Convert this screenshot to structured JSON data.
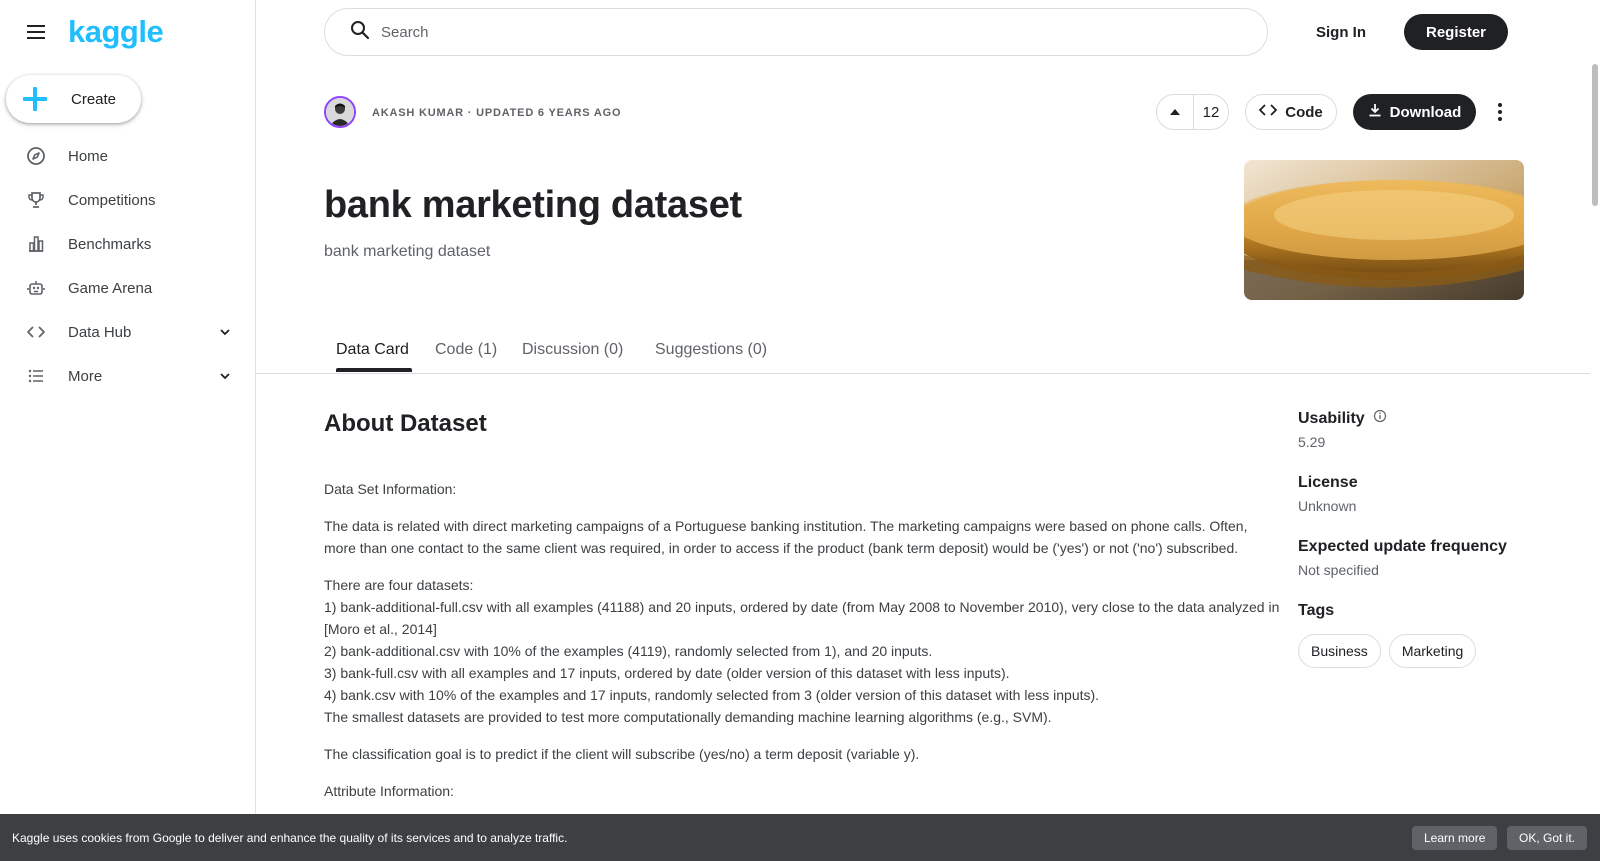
{
  "brand": {
    "logo_text": "kaggle",
    "accent": "#20beff",
    "dark": "#202124"
  },
  "sidebar": {
    "create_label": "Create",
    "items": [
      {
        "label": "Home",
        "icon": "compass-icon"
      },
      {
        "label": "Competitions",
        "icon": "trophy-icon"
      },
      {
        "label": "Benchmarks",
        "icon": "bar-chart-icon"
      },
      {
        "label": "Game Arena",
        "icon": "robot-icon"
      },
      {
        "label": "Data Hub",
        "icon": "code-icon",
        "expandable": true
      },
      {
        "label": "More",
        "icon": "list-icon",
        "expandable": true
      }
    ]
  },
  "header": {
    "search_placeholder": "Search",
    "sign_in": "Sign In",
    "register": "Register"
  },
  "dataset": {
    "owner": "AKASH KUMAR",
    "separator": " · ",
    "updated": "UPDATED 6 YEARS AGO",
    "votes": "12",
    "code_label": "Code",
    "download_label": "Download",
    "title": "bank marketing dataset",
    "subtitle": "bank marketing dataset"
  },
  "tabs": [
    {
      "label": "Data Card",
      "active": true
    },
    {
      "label": "Code (1)"
    },
    {
      "label": "Discussion (0)"
    },
    {
      "label": "Suggestions (0)"
    }
  ],
  "about": {
    "heading": "About Dataset",
    "p1": "Data Set Information:",
    "p2": "The data is related with direct marketing campaigns of a Portuguese banking institution. The marketing campaigns were based on phone calls. Often, more than one contact to the same client was required, in order to access if the product (bank term deposit) would be ('yes') or not ('no') subscribed.",
    "p3_lines": [
      "There are four datasets:",
      "1) bank-additional-full.csv with all examples (41188) and 20 inputs, ordered by date (from May 2008 to November 2010), very close to the data analyzed in [Moro et al., 2014]",
      "2) bank-additional.csv with 10% of the examples (4119), randomly selected from 1), and 20 inputs.",
      "3) bank-full.csv with all examples and 17 inputs, ordered by date (older version of this dataset with less inputs).",
      "4) bank.csv with 10% of the examples and 17 inputs, randomly selected from 3 (older version of this dataset with less inputs).",
      "The smallest datasets are provided to test more computationally demanding machine learning algorithms (e.g., SVM)."
    ],
    "p4": "The classification goal is to predict if the client will subscribe (yes/no) a term deposit (variable y).",
    "p5": "Attribute Information:"
  },
  "meta": {
    "usability_label": "Usability",
    "usability_value": "5.29",
    "license_label": "License",
    "license_value": "Unknown",
    "frequency_label": "Expected update frequency",
    "frequency_value": "Not specified",
    "tags_label": "Tags",
    "tags": [
      "Business",
      "Marketing"
    ]
  },
  "cookie": {
    "text": "Kaggle uses cookies from Google to deliver and enhance the quality of its services and to analyze traffic.",
    "learn_more": "Learn more",
    "ok": "OK, Got it."
  }
}
